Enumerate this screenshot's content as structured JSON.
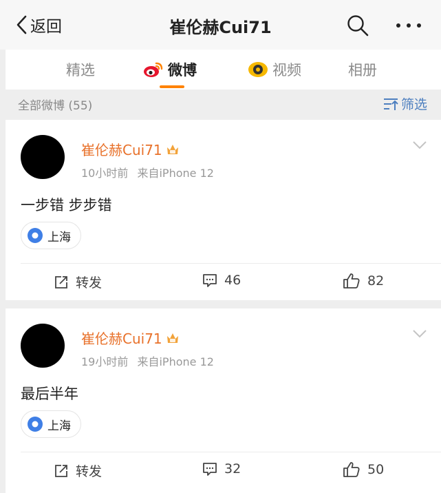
{
  "nav": {
    "back_label": "返回",
    "title": "崔伦赫Cui71"
  },
  "tabs": [
    {
      "label": "精选"
    },
    {
      "label": "微博"
    },
    {
      "label": "视频"
    },
    {
      "label": "相册"
    }
  ],
  "filter": {
    "count_label": "全部微博 (55)",
    "button_label": "筛选"
  },
  "posts": [
    {
      "author": "崔伦赫Cui71",
      "time": "10小时前",
      "source": "来自iPhone 12",
      "text": "一步错 步步错",
      "location": "上海",
      "repost_label": "转发",
      "comments": "46",
      "likes": "82"
    },
    {
      "author": "崔伦赫Cui71",
      "time": "19小时前",
      "source": "来自iPhone 12",
      "text": "最后半年",
      "location": "上海",
      "repost_label": "转发",
      "comments": "32",
      "likes": "50"
    }
  ],
  "colors": {
    "accent_orange": "#ff8200",
    "author_orange": "#e8712a",
    "filter_blue": "#4d7fbf",
    "location_blue": "#3f7fe6"
  },
  "icons": {
    "back": "chevron-left-icon",
    "search": "search-icon",
    "more": "more-dots-icon",
    "weibo": "weibo-logo-icon",
    "video": "video-icon",
    "filter": "filter-icon",
    "vip": "vip-crown-icon",
    "expand": "chevron-down-icon",
    "location": "location-pin-icon",
    "repost": "repost-icon",
    "comment": "comment-icon",
    "like": "like-icon"
  }
}
